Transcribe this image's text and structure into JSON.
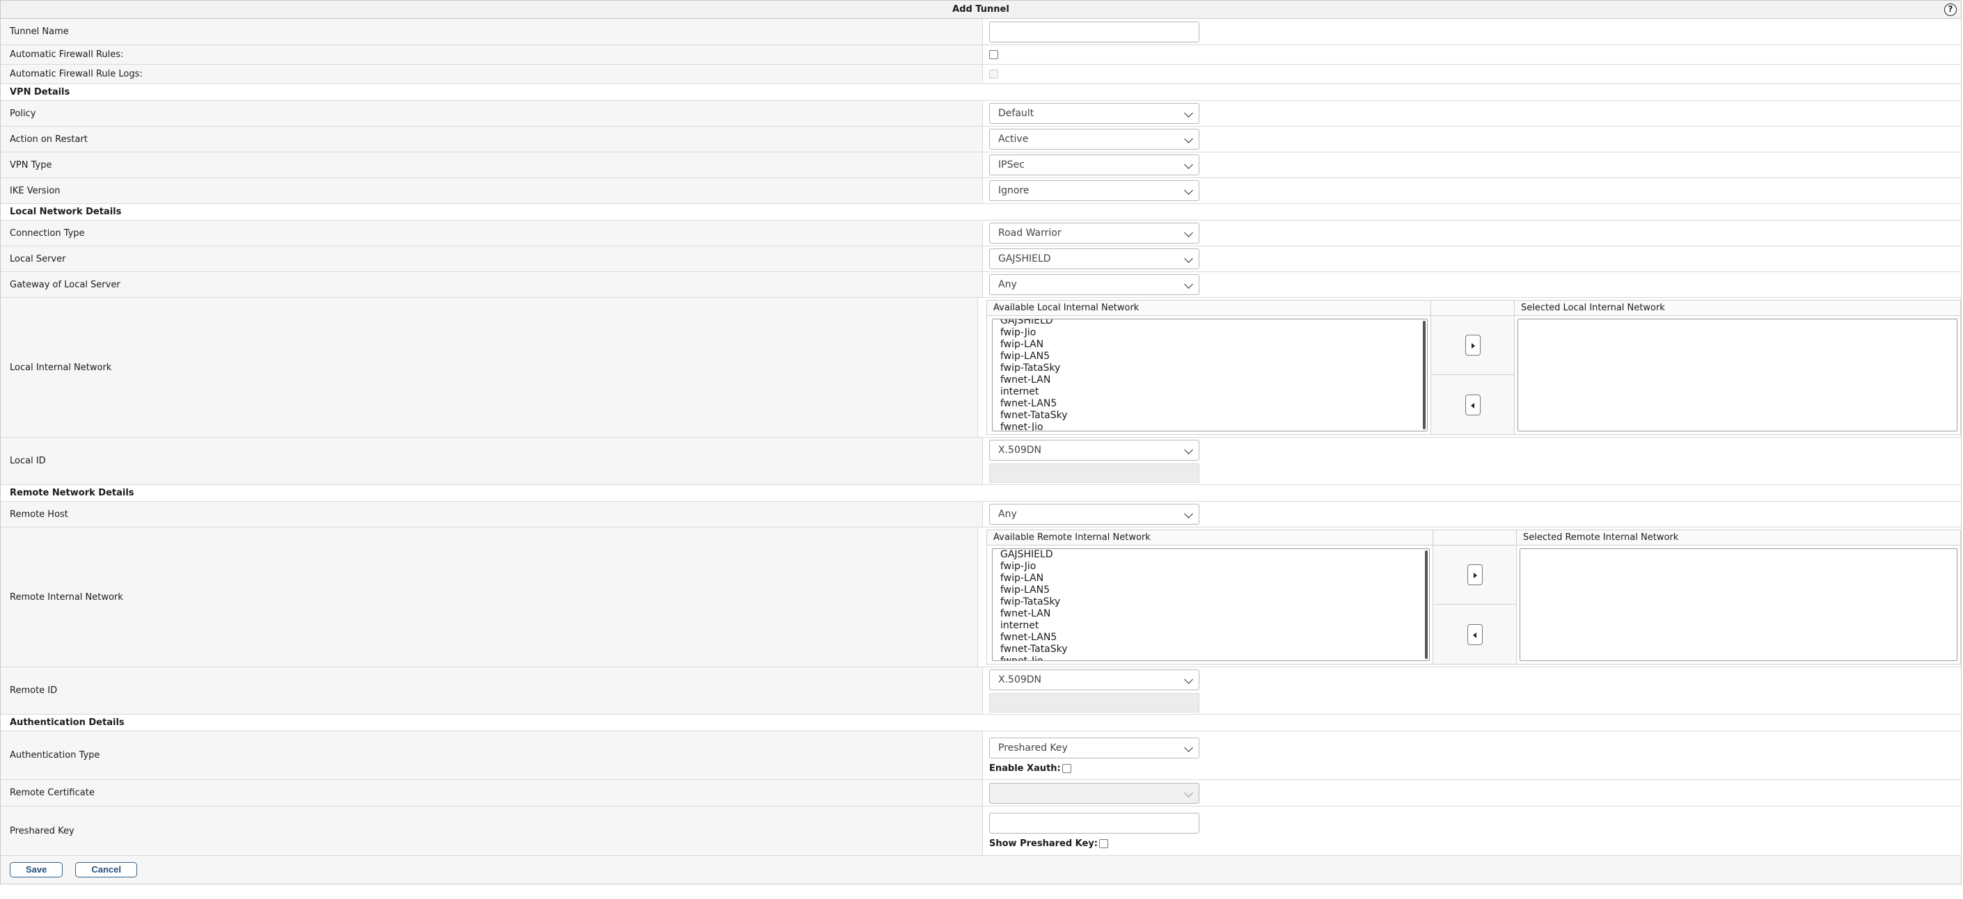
{
  "title": "Add Tunnel",
  "help_icon": "?",
  "fields": {
    "tunnel_name": "Tunnel Name",
    "auto_fw_rules": "Automatic Firewall Rules:",
    "auto_fw_logs": "Automatic Firewall Rule Logs:",
    "policy": "Policy",
    "action_restart": "Action on Restart",
    "vpn_type": "VPN Type",
    "ike_version": "IKE Version",
    "connection_type": "Connection Type",
    "local_server": "Local Server",
    "gateway_local": "Gateway of Local Server",
    "local_internal_network": "Local Internal Network",
    "local_id": "Local ID",
    "remote_host": "Remote Host",
    "remote_internal_network": "Remote Internal Network",
    "remote_id": "Remote ID",
    "auth_type": "Authentication Type",
    "remote_cert": "Remote Certificate",
    "preshared_key": "Preshared Key"
  },
  "sections": {
    "vpn": "VPN Details",
    "local": "Local Network Details",
    "remote": "Remote Network Details",
    "auth": "Authentication Details"
  },
  "values": {
    "policy": "Default",
    "action_restart": "Active",
    "vpn_type": "IPSec",
    "ike_version": "Ignore",
    "connection_type": "Road Warrior",
    "local_server": "GAJSHIELD",
    "gateway_local": "Any",
    "local_id": "X.509DN",
    "remote_host": "Any",
    "remote_id": "X.509DN",
    "auth_type": "Preshared Key",
    "enable_xauth": "Enable Xauth:",
    "show_psk": "Show Preshared Key:"
  },
  "local_net": {
    "available_header": "Available Local Internal Network",
    "selected_header": "Selected Local Internal Network",
    "items": [
      "GAJSHIELD",
      "fwip-Jio",
      "fwip-LAN",
      "fwip-LAN5",
      "fwip-TataSky",
      "fwnet-LAN",
      "internet",
      "fwnet-LAN5",
      "fwnet-TataSky",
      "fwnet-Jio"
    ]
  },
  "remote_net": {
    "available_header": "Available Remote Internal Network",
    "selected_header": "Selected Remote Internal Network",
    "items": [
      "GAJSHIELD",
      "fwip-Jio",
      "fwip-LAN",
      "fwip-LAN5",
      "fwip-TataSky",
      "fwnet-LAN",
      "internet",
      "fwnet-LAN5",
      "fwnet-TataSky",
      "fwnet-Jio"
    ]
  },
  "buttons": {
    "save": "Save",
    "cancel": "Cancel"
  },
  "icons": [
    "help-icon",
    "chevron-down-icon",
    "arrow-right-icon",
    "arrow-left-icon"
  ]
}
